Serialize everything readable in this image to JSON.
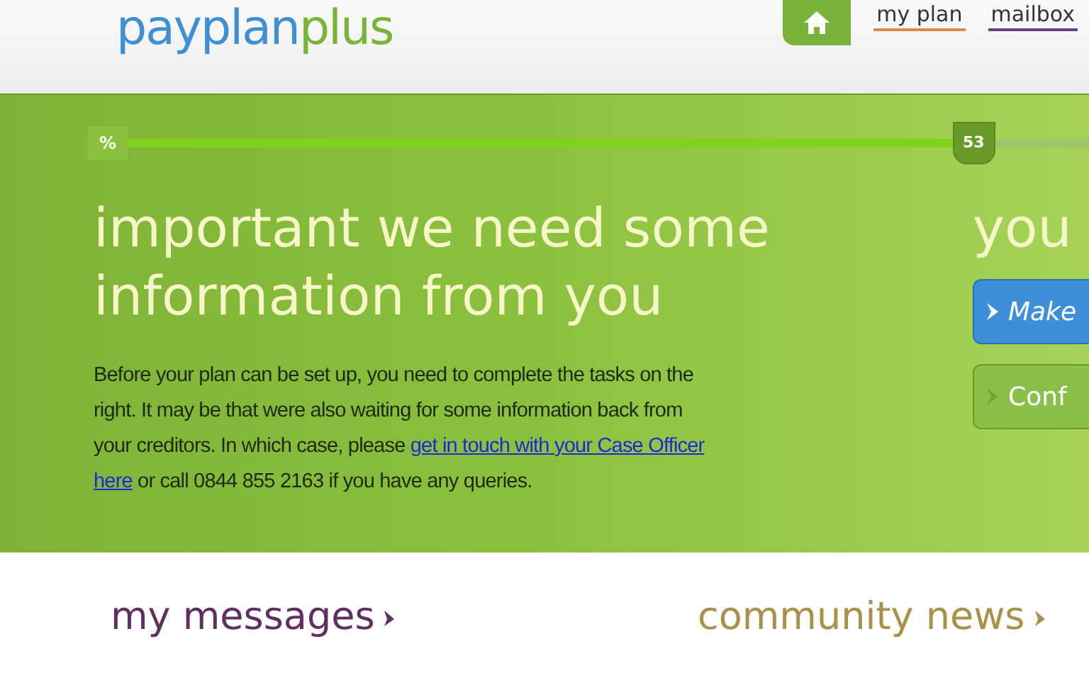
{
  "header": {
    "logo": [
      "payplan",
      "plus"
    ],
    "nav": [
      {
        "kind": "home",
        "selected": true
      },
      {
        "kind": "link",
        "label": "my plan",
        "color": "#d9894a",
        "selected": false
      },
      {
        "kind": "link",
        "label": "mailbox",
        "color": "#6b3f7f",
        "selected": false
      }
    ]
  },
  "progress": {
    "start_label": "%",
    "level": 0.88,
    "value_label": "53"
  },
  "notice": {
    "title": "important we need some information from you",
    "lines": [
      "Before your plan can be set up, you need to complete the tasks on the",
      "right. It may be that were also waiting for some information back from",
      "your creditors. In which case, please "
    ],
    "links": [
      "get in touch with your Case Officer",
      "here"
    ],
    "tail": " or call 0844 855 2163 if you have any queries."
  },
  "tasks": {
    "title": "you",
    "buttons": [
      {
        "kind": "primary",
        "label": "Make"
      },
      {
        "kind": "secondary",
        "label": "Conf"
      }
    ]
  },
  "sections": [
    {
      "title": "my messages",
      "color": "#5e2f5f"
    },
    {
      "title": "community news",
      "color": "#a8924a"
    }
  ]
}
